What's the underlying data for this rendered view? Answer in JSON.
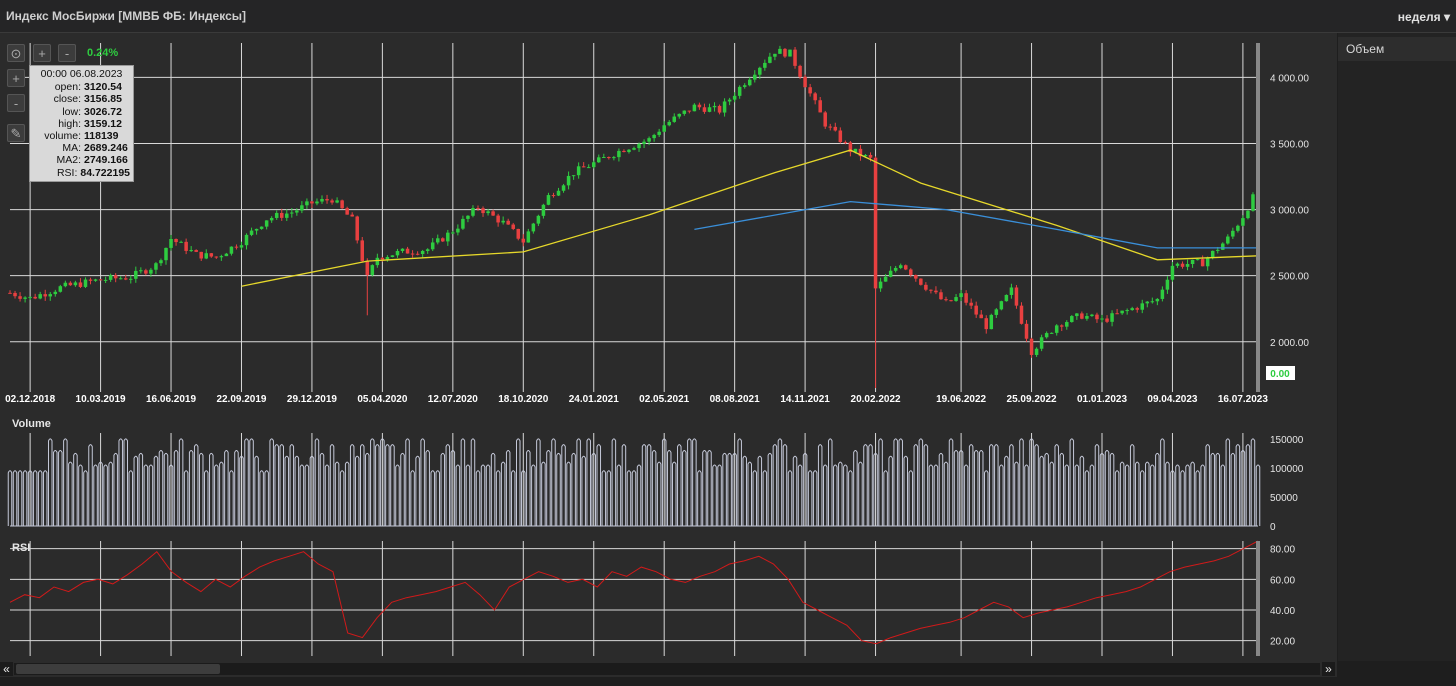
{
  "window": {
    "title": "Индекс МосБиржи [ММВБ ФБ: Индексы]",
    "period": "неделя ▾"
  },
  "toolbar": {
    "reset_icon": "target-icon",
    "zoom_in": "+",
    "zoom_out": "-",
    "y_zoom_in": "+",
    "y_zoom_out": "-",
    "pencil_icon": "pencil-icon",
    "change_pct": "0.24%"
  },
  "tooltip": {
    "date": "00:00 06.08.2023",
    "rows": [
      {
        "k": "open:",
        "v": "3120.54"
      },
      {
        "k": "close:",
        "v": "3156.85"
      },
      {
        "k": "low:",
        "v": "3026.72"
      },
      {
        "k": "high:",
        "v": "3159.12"
      },
      {
        "k": "volume:",
        "v": "118139"
      },
      {
        "k": "MA:",
        "v": "2689.246"
      },
      {
        "k": "MA2:",
        "v": "2749.166"
      },
      {
        "k": "RSI:",
        "v": "84.722195"
      }
    ]
  },
  "right_panel": {
    "tab": "Объем"
  },
  "colors": {
    "up": "#2ecc40",
    "down": "#e84040",
    "ma": "#e6d82a",
    "ma2": "#3a8fd9",
    "rsi": "#d11a1a",
    "volume": "#c4c8d8",
    "grid": "#d9d9d9",
    "background": "#2b2b2b"
  },
  "chart_data": [
    {
      "type": "candlestick",
      "pane": "price",
      "x_ticks": [
        "02.12.2018",
        "10.03.2019",
        "16.06.2019",
        "22.09.2019",
        "29.12.2019",
        "05.04.2020",
        "12.07.2020",
        "18.10.2020",
        "24.01.2021",
        "02.05.2021",
        "08.08.2021",
        "14.11.2021",
        "20.02.2022",
        "19.06.2022",
        "25.09.2022",
        "01.01.2023",
        "09.04.2023",
        "16.07.2023"
      ],
      "y_ticks": [
        "2 000.00",
        "2 500.00",
        "3 000.00",
        "3 500.00",
        "4 000.00"
      ],
      "ylim": [
        1620,
        4260
      ],
      "current_value_label": "0.00",
      "close_path": [
        [
          "2018-11-04",
          2370
        ],
        [
          "2018-12-02",
          2330
        ],
        [
          "2019-01-13",
          2410
        ],
        [
          "2019-03-10",
          2470
        ],
        [
          "2019-04-21",
          2490
        ],
        [
          "2019-05-26",
          2580
        ],
        [
          "2019-06-16",
          2780
        ],
        [
          "2019-07-21",
          2660
        ],
        [
          "2019-08-18",
          2640
        ],
        [
          "2019-09-22",
          2760
        ],
        [
          "2019-10-27",
          2930
        ],
        [
          "2019-12-01",
          2980
        ],
        [
          "2019-12-29",
          3050
        ],
        [
          "2020-01-26",
          3080
        ],
        [
          "2020-02-23",
          2920
        ],
        [
          "2020-03-15",
          2480
        ],
        [
          "2020-03-29",
          2640
        ],
        [
          "2020-05-03",
          2680
        ],
        [
          "2020-06-07",
          2700
        ],
        [
          "2020-07-12",
          2840
        ],
        [
          "2020-08-16",
          3020
        ],
        [
          "2020-09-20",
          2900
        ],
        [
          "2020-10-18",
          2760
        ],
        [
          "2020-11-22",
          3100
        ],
        [
          "2020-12-27",
          3280
        ],
        [
          "2021-01-24",
          3350
        ],
        [
          "2021-03-07",
          3460
        ],
        [
          "2021-04-11",
          3530
        ],
        [
          "2021-05-02",
          3640
        ],
        [
          "2021-06-13",
          3780
        ],
        [
          "2021-07-18",
          3750
        ],
        [
          "2021-08-08",
          3880
        ],
        [
          "2021-09-05",
          4050
        ],
        [
          "2021-10-03",
          4200
        ],
        [
          "2021-10-24",
          4180
        ],
        [
          "2021-11-14",
          3950
        ],
        [
          "2021-12-12",
          3650
        ],
        [
          "2022-01-16",
          3450
        ],
        [
          "2022-02-13",
          3380
        ],
        [
          "2022-02-20",
          2400
        ],
        [
          "2022-03-27",
          2600
        ],
        [
          "2022-04-24",
          2450
        ],
        [
          "2022-05-29",
          2290
        ],
        [
          "2022-06-19",
          2350
        ],
        [
          "2022-07-24",
          2120
        ],
        [
          "2022-08-28",
          2390
        ],
        [
          "2022-09-25",
          1930
        ],
        [
          "2022-10-30",
          2130
        ],
        [
          "2022-12-04",
          2200
        ],
        [
          "2023-01-01",
          2160
        ],
        [
          "2023-02-12",
          2250
        ],
        [
          "2023-03-19",
          2320
        ],
        [
          "2023-04-09",
          2580
        ],
        [
          "2023-05-21",
          2600
        ],
        [
          "2023-06-25",
          2780
        ],
        [
          "2023-07-16",
          2950
        ],
        [
          "2023-08-06",
          3157
        ]
      ],
      "series": [
        {
          "name": "MA",
          "values": [
            [
              "2019-09-22",
              2420
            ],
            [
              "2020-03-15",
              2610
            ],
            [
              "2020-10-18",
              2680
            ],
            [
              "2021-04-11",
              2960
            ],
            [
              "2021-10-03",
              3280
            ],
            [
              "2022-01-16",
              3450
            ],
            [
              "2022-04-24",
              3200
            ],
            [
              "2022-10-30",
              2880
            ],
            [
              "2023-03-19",
              2620
            ],
            [
              "2023-08-06",
              2650
            ]
          ]
        },
        {
          "name": "MA2",
          "values": [
            [
              "2021-06-13",
              2850
            ],
            [
              "2022-01-16",
              3060
            ],
            [
              "2022-05-29",
              3000
            ],
            [
              "2022-10-30",
              2850
            ],
            [
              "2023-03-19",
              2710
            ],
            [
              "2023-08-06",
              2710
            ]
          ]
        }
      ]
    },
    {
      "type": "bar",
      "pane": "Volume",
      "title": "Volume",
      "y_ticks": [
        "0",
        "50000",
        "100000",
        "150000"
      ],
      "ylim": [
        0,
        160000
      ],
      "typical_values": [
        95000,
        105000,
        110000,
        120000,
        125000,
        130000,
        140000,
        150000
      ]
    },
    {
      "type": "line",
      "pane": "RSI",
      "title": "RSI",
      "y_ticks": [
        "20.00",
        "40.00",
        "60.00",
        "80.00"
      ],
      "ylim": [
        10,
        85
      ],
      "values": [
        45,
        50,
        48,
        55,
        52,
        58,
        60,
        57,
        63,
        70,
        78,
        65,
        58,
        52,
        60,
        55,
        62,
        68,
        72,
        75,
        78,
        70,
        65,
        25,
        22,
        35,
        45,
        48,
        50,
        52,
        55,
        58,
        50,
        40,
        55,
        60,
        65,
        62,
        58,
        60,
        55,
        65,
        62,
        68,
        65,
        60,
        58,
        62,
        65,
        70,
        72,
        75,
        70,
        60,
        45,
        40,
        35,
        30,
        20,
        18,
        22,
        25,
        28,
        30,
        32,
        35,
        40,
        45,
        42,
        35,
        38,
        40,
        42,
        45,
        48,
        50,
        52,
        55,
        60,
        65,
        68,
        70,
        72,
        75,
        80,
        85
      ]
    }
  ]
}
